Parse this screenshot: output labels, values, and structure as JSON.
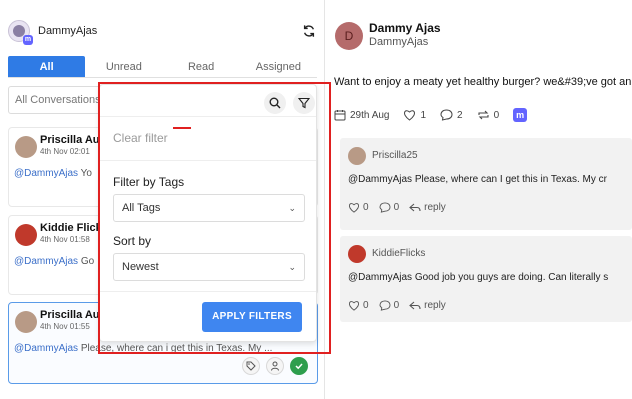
{
  "account": {
    "name": "DammyAjas",
    "platform_badge": "m"
  },
  "tabs": [
    {
      "label": "All",
      "active": true
    },
    {
      "label": "Unread",
      "active": false
    },
    {
      "label": "Read",
      "active": false
    },
    {
      "label": "Assigned",
      "active": false
    }
  ],
  "conversation_filter": {
    "value": "All Conversations"
  },
  "conversations": [
    {
      "name": "Priscilla Aul",
      "date": "4th Nov 02:01",
      "mention": "@DammyAjas",
      "preview": " Yo"
    },
    {
      "name": "Kiddie Flicks",
      "date": "4th Nov 01:58",
      "mention": "@DammyAjas",
      "preview": " Go"
    },
    {
      "name": "Priscilla Aul",
      "date": "4th Nov 01:55",
      "mention": "@DammyAjas",
      "preview": " Please, where can i get this in Texas. My ..."
    }
  ],
  "filter_panel": {
    "clear_label": "Clear filter",
    "tags_label": "Filter by Tags",
    "tags_value": "All Tags",
    "sort_label": "Sort by",
    "sort_value": "Newest",
    "apply_label": "APPLY FILTERS"
  },
  "thread": {
    "avatar_initial": "D",
    "name": "Dammy Ajas",
    "handle": "DammyAjas",
    "post_text": "Want to enjoy a meaty yet healthy burger? we&#39;ve got an",
    "date": "29th Aug",
    "likes": "1",
    "comments": "2",
    "reposts": "0"
  },
  "replies": [
    {
      "user": "Priscilla25",
      "mention": "@DammyAjas",
      "text": " Please, where can I get this in Texas. My cr",
      "likes": "0",
      "comments": "0",
      "reply_label": "reply"
    },
    {
      "user": "KiddieFlicks",
      "mention": "@DammyAjas",
      "text": " Good job you guys are doing. Can literally s",
      "likes": "0",
      "comments": "0",
      "reply_label": "reply"
    }
  ],
  "colors": {
    "accent": "#2f7be5",
    "apply": "#3f86f0",
    "highlight": "#e02020",
    "mastodon": "#6364ff",
    "ok": "#2e9e4d"
  }
}
